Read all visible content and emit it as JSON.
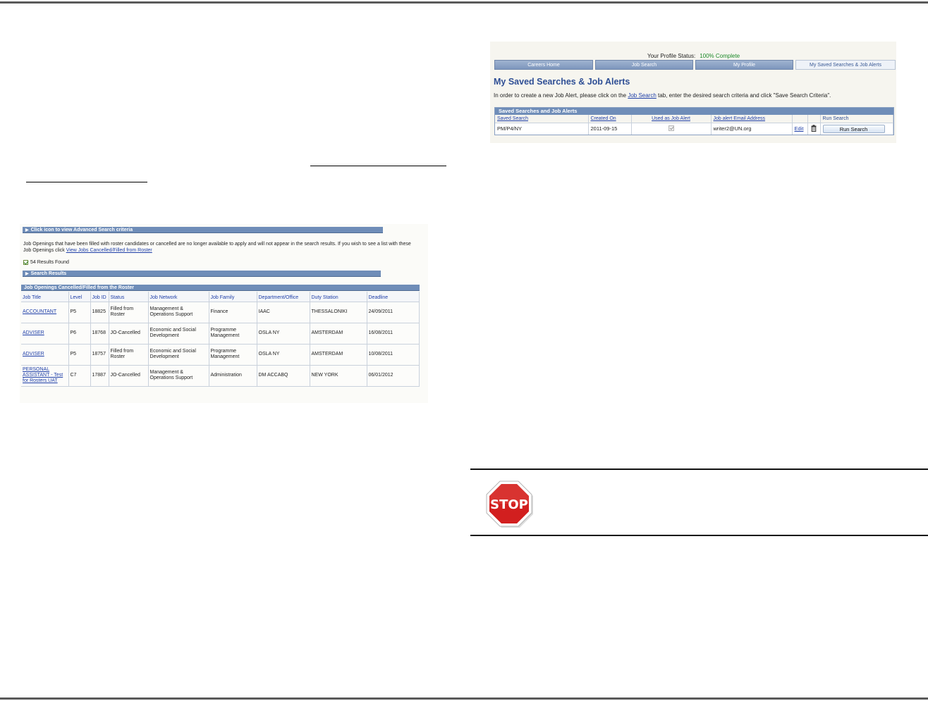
{
  "colors": {
    "accent_blue": "#2f4f95",
    "bar_blue": "#6f8db8",
    "link_blue": "#1f3fa8",
    "complete_green": "#1d8a2a",
    "stop_red": "#d21f1f"
  },
  "job_search": {
    "advanced_bar": "Click icon to view Advanced Search criteria",
    "notice_text": "Job Openings that have been filled with roster candidates or cancelled are no longer available to apply and will not appear in the search results. If you wish to see a list with these Job Openings click",
    "notice_link": "View Jobs Cancelled/Filled from Roster",
    "results_found": "54 Results Found",
    "results_bar": "Search Results",
    "table_bar": "Job Openings Cancelled/Filled from the Roster",
    "columns": [
      "Job Title",
      "Level",
      "Job ID",
      "Status",
      "Job Network",
      "Job Family",
      "Department/Office",
      "Duty Station",
      "Deadline"
    ],
    "rows": [
      [
        "ACCOUNTANT",
        "P5",
        "18825",
        "Filled from Roster",
        "Management & Operations Support",
        "Finance",
        "IAAC",
        "THESSALONIKI",
        "24/09/2011"
      ],
      [
        "ADVISER",
        "P6",
        "18768",
        "JO-Cancelled",
        "Economic and Social Development",
        "Programme Management",
        "OSLA NY",
        "AMSTERDAM",
        "16/08/2011"
      ],
      [
        "ADVISER",
        "P5",
        "18757",
        "Filled from Roster",
        "Economic and Social Development",
        "Programme Management",
        "OSLA NY",
        "AMSTERDAM",
        "10/08/2011"
      ],
      [
        "PERSONAL ASSISTANT - Test for Rosters UAT",
        "C7",
        "17887",
        "JO-Cancelled",
        "Management & Operations Support",
        "Administration",
        "DM ACCABQ",
        "NEW YORK",
        "06/01/2012"
      ]
    ]
  },
  "saved_searches": {
    "profile_label": "Your Profile Status:",
    "profile_value": "100% Complete",
    "tabs": [
      "Careers Home",
      "Job Search",
      "My Profile",
      "My Saved Searches & Job Alerts"
    ],
    "title": "My Saved Searches & Job Alerts",
    "desc_before": "In order to create a new Job Alert, please click on the",
    "desc_link": "Job Search",
    "desc_after": "tab, enter the desired search criteria and click \"Save Search Criteria\".",
    "grid_bar": "Saved Searches and Job Alerts",
    "columns": [
      "Saved Search",
      "Created On",
      "Used as Job Alert",
      "Job alert Email Address",
      "",
      "",
      "Run Search"
    ],
    "row": {
      "name": "PM/P4/NY",
      "created": "2011-09-15",
      "email": "writer2@UN.org",
      "edit": "Edit",
      "run": "Run Search"
    }
  },
  "stop_sign": {
    "label": "STOP"
  }
}
